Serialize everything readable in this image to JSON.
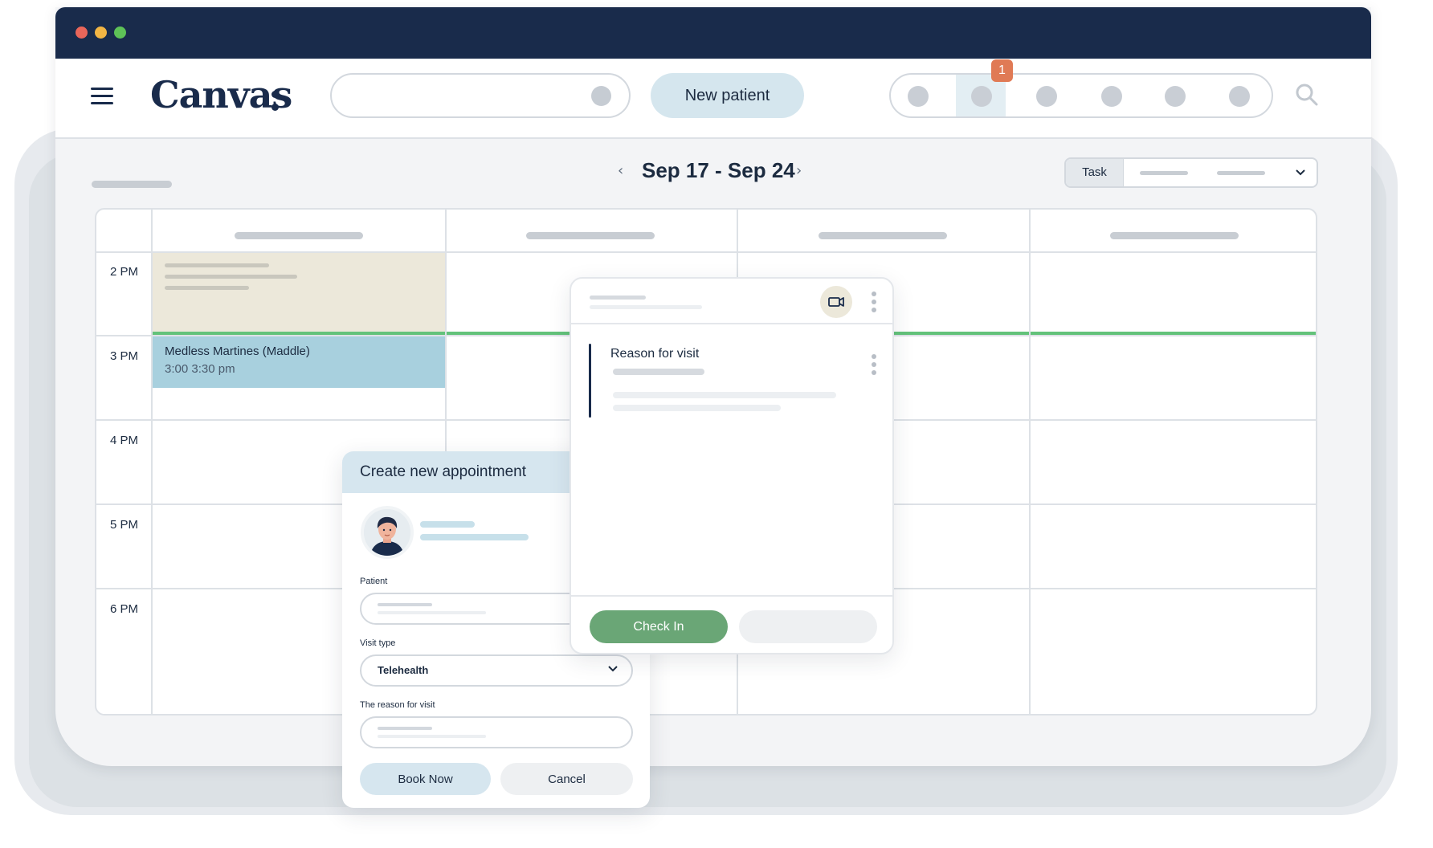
{
  "app": {
    "logo_text": "Canvas",
    "new_patient_label": "New patient",
    "notification_count": "1",
    "nav_icons": [
      "nav-circle-1",
      "nav-circle-2",
      "nav-circle-3",
      "nav-circle-4",
      "nav-circle-5",
      "nav-circle-6"
    ]
  },
  "toolbar": {
    "date_range": "Sep 17 - Sep 24",
    "prev_glyph": "‹",
    "next_glyph": "›",
    "view_label": "Task"
  },
  "calendar": {
    "time_slots": [
      "2 PM",
      "3 PM",
      "4 PM",
      "5 PM",
      "6 PM"
    ],
    "appointment": {
      "name": "Medless Martines (Maddle)",
      "time": "3:00 3:30 pm"
    }
  },
  "create_appointment": {
    "title": "Create new appointment",
    "patient_label": "Patient",
    "visit_type_label": "Visit type",
    "visit_type_value": "Telehealth",
    "reason_label": "The reason for visit",
    "book_label": "Book Now",
    "cancel_label": "Cancel"
  },
  "detail": {
    "reason_title": "Reason for visit",
    "check_in_label": "Check In"
  },
  "colors": {
    "navy": "#192b4b",
    "accent_light_blue": "#d6e6ef",
    "appointment_blue": "#a8d0de",
    "beige_block": "#ece8da",
    "now_line_green": "#63c27a",
    "check_in_green": "#6aa676",
    "badge_orange": "#e07a55"
  }
}
